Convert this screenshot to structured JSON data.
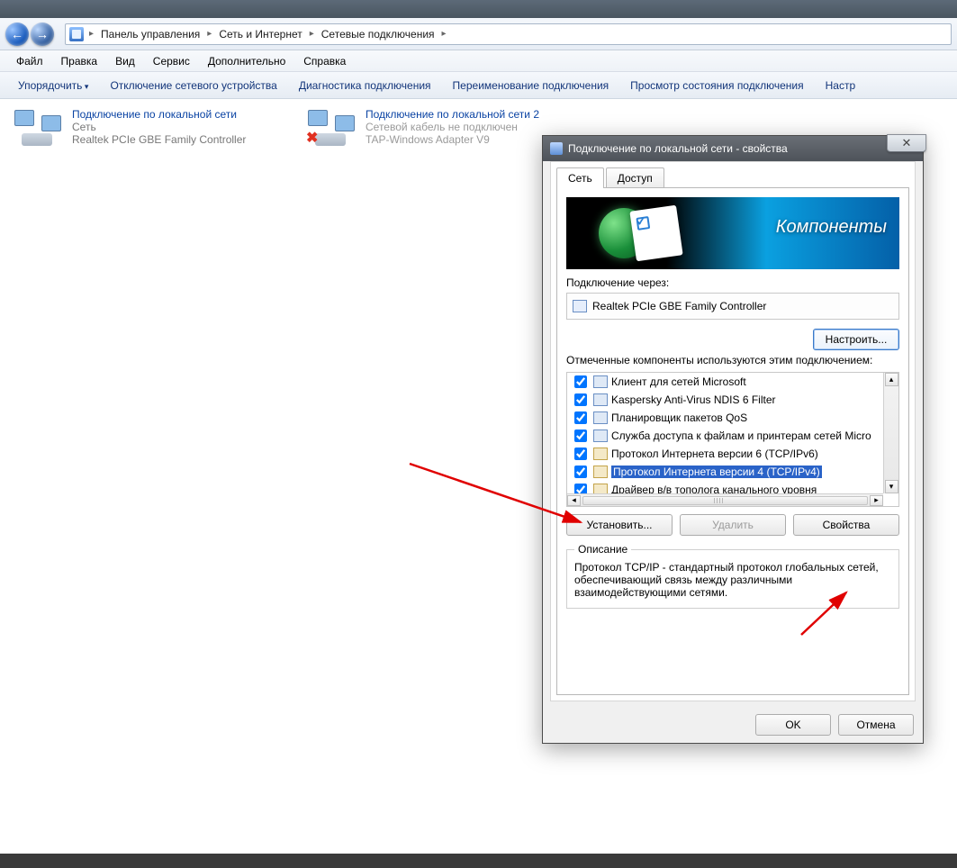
{
  "titlestrip": {},
  "addr": {
    "back_aria": "←",
    "fwd_aria": "→",
    "segs": [
      "Панель управления",
      "Сеть и Интернет",
      "Сетевые подключения"
    ]
  },
  "menubar": [
    "Файл",
    "Правка",
    "Вид",
    "Сервис",
    "Дополнительно",
    "Справка"
  ],
  "toolbar": [
    "Упорядочить",
    "Отключение сетевого устройства",
    "Диагностика подключения",
    "Переименование подключения",
    "Просмотр состояния подключения",
    "Настр"
  ],
  "connections": [
    {
      "name": "Подключение по локальной сети",
      "l2": "Сеть",
      "l3": "Realtek PCIe GBE Family Controller",
      "disabled": false
    },
    {
      "name": "Подключение по локальной сети 2",
      "l2": "Сетевой кабель не подключен",
      "l3": "TAP-Windows Adapter V9",
      "disabled": true
    }
  ],
  "dialog": {
    "title": "Подключение по локальной сети - свойства",
    "tabs": {
      "net": "Сеть",
      "access": "Доступ"
    },
    "banner": "Компоненты",
    "through_label": "Подключение через:",
    "through_value": "Realtek PCIe GBE Family Controller",
    "configure": "Настроить...",
    "components_label": "Отмеченные компоненты используются этим подключением:",
    "components": [
      {
        "checked": true,
        "icon": "b",
        "name": "Клиент для сетей Microsoft"
      },
      {
        "checked": true,
        "icon": "b",
        "name": "Kaspersky Anti-Virus NDIS 6 Filter"
      },
      {
        "checked": true,
        "icon": "b",
        "name": "Планировщик пакетов QoS"
      },
      {
        "checked": true,
        "icon": "b",
        "name": "Служба доступа к файлам и принтерам сетей Micro"
      },
      {
        "checked": true,
        "icon": "y",
        "name": "Протокол Интернета версии 6 (TCP/IPv6)"
      },
      {
        "checked": true,
        "icon": "y",
        "name": "Протокол Интернета версии 4 (TCP/IPv4)",
        "selected": true
      },
      {
        "checked": true,
        "icon": "y",
        "name": "Драйвер в/в тополога канального уровня"
      }
    ],
    "install": "Установить...",
    "remove": "Удалить",
    "props": "Свойства",
    "desc_legend": "Описание",
    "desc_text": "Протокол TCP/IP - стандартный протокол глобальных сетей, обеспечивающий связь между различными взаимодействующими сетями.",
    "ok": "OK",
    "cancel": "Отмена",
    "close_x": "✕"
  }
}
